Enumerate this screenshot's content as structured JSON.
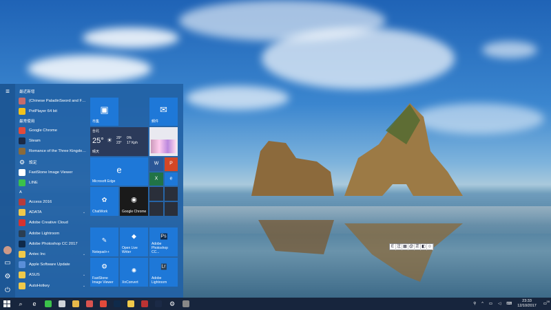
{
  "start_menu": {
    "sections": {
      "recent": "最近新增",
      "most_used": "最常使用",
      "letter_a": "A"
    },
    "recent_items": [
      {
        "label": "(Chinese PaladinSword and Fai...",
        "icon": "paladin-game-icon",
        "color": "#c76b6b"
      },
      {
        "label": "PotPlayer 64 bit",
        "icon": "potplayer-icon",
        "color": "#f2c21b"
      }
    ],
    "most_used_items": [
      {
        "label": "Google Chrome",
        "icon": "chrome-icon",
        "color": "#e24a3b"
      },
      {
        "label": "Steam",
        "icon": "steam-icon",
        "color": "#1b2a46"
      },
      {
        "label": "Romance of the Three Kingdom...",
        "icon": "three-kingdoms-icon",
        "color": "#8a6a3a"
      },
      {
        "label": "設定",
        "icon": "settings-gear-icon",
        "color": "transparent"
      },
      {
        "label": "FastStone Image Viewer",
        "icon": "faststone-icon",
        "color": "#ffffff"
      },
      {
        "label": "LINE",
        "icon": "line-icon",
        "color": "#3bc24a"
      }
    ],
    "a_items": [
      {
        "label": "Access 2016",
        "icon": "access-icon",
        "color": "#b73b3b",
        "chevron": ""
      },
      {
        "label": "ADATA",
        "icon": "folder-icon",
        "color": "#f0c94a",
        "chevron": "⌄"
      },
      {
        "label": "Adobe Creative Cloud",
        "icon": "creative-cloud-icon",
        "color": "#d8322e",
        "chevron": ""
      },
      {
        "label": "Adobe Lightroom",
        "icon": "lightroom-icon",
        "color": "#2b3e52",
        "chevron": ""
      },
      {
        "label": "Adobe Photoshop CC 2017",
        "icon": "photoshop-icon",
        "color": "#0f2a4a",
        "chevron": ""
      },
      {
        "label": "Antec Inc",
        "icon": "folder-icon",
        "color": "#f0c94a",
        "chevron": "⌄"
      },
      {
        "label": "Apple Software Update",
        "icon": "apple-update-icon",
        "color": "#5a8fd8",
        "chevron": ""
      },
      {
        "label": "ASUS",
        "icon": "folder-icon",
        "color": "#f0c94a",
        "chevron": "⌄"
      },
      {
        "label": "AutoHotkey",
        "icon": "folder-icon",
        "color": "#f0c94a",
        "chevron": "⌄"
      }
    ],
    "tiles": {
      "store": "市集",
      "mail": "郵件",
      "weather_city": "台北",
      "weather_temp": "25°",
      "weather_low": "29°",
      "weather_high": "23°",
      "weather_rain": "0%",
      "weather_wind": "17 Kph",
      "weather_desc": "晴天",
      "edge": "Microsoft Edge",
      "chatwork": "ChatWork",
      "chrome": "Google Chrome",
      "notepad": "Notepad++",
      "olw": "Open Live Writer",
      "photoshop": "Adobe Photoshop CC...",
      "faststone": "FastStone Image Viewer",
      "xnconvert": "XnConvert",
      "lightroom": "Adobe Lightroom"
    }
  },
  "taskbar": {
    "time": "23:33",
    "date": "12/10/2017",
    "notification_count": "16",
    "pinned": [
      {
        "name": "search-icon",
        "glyph": "⌕"
      },
      {
        "name": "edge-icon",
        "glyph": "e"
      },
      {
        "name": "line-taskbar-icon",
        "glyph": ""
      },
      {
        "name": "chatwork-taskbar-icon",
        "glyph": ""
      },
      {
        "name": "explorer-icon",
        "glyph": ""
      },
      {
        "name": "paint-icon",
        "glyph": ""
      },
      {
        "name": "chrome-taskbar-icon",
        "glyph": ""
      },
      {
        "name": "photoshop-taskbar-icon",
        "glyph": ""
      },
      {
        "name": "folder-taskbar-icon",
        "glyph": ""
      },
      {
        "name": "xnconvert-taskbar-icon",
        "glyph": ""
      },
      {
        "name": "steam-taskbar-icon",
        "glyph": ""
      },
      {
        "name": "settings-taskbar-icon",
        "glyph": "⚙"
      },
      {
        "name": "paint-app-taskbar-icon",
        "glyph": ""
      }
    ]
  },
  "ime_toolbar": [
    "E",
    "注",
    "▦",
    "@",
    "正",
    "◧",
    "☺"
  ],
  "colors": {
    "tile_blue": "#1e78d8",
    "taskbar": "#17253d",
    "start_bg": "#2262a6"
  }
}
